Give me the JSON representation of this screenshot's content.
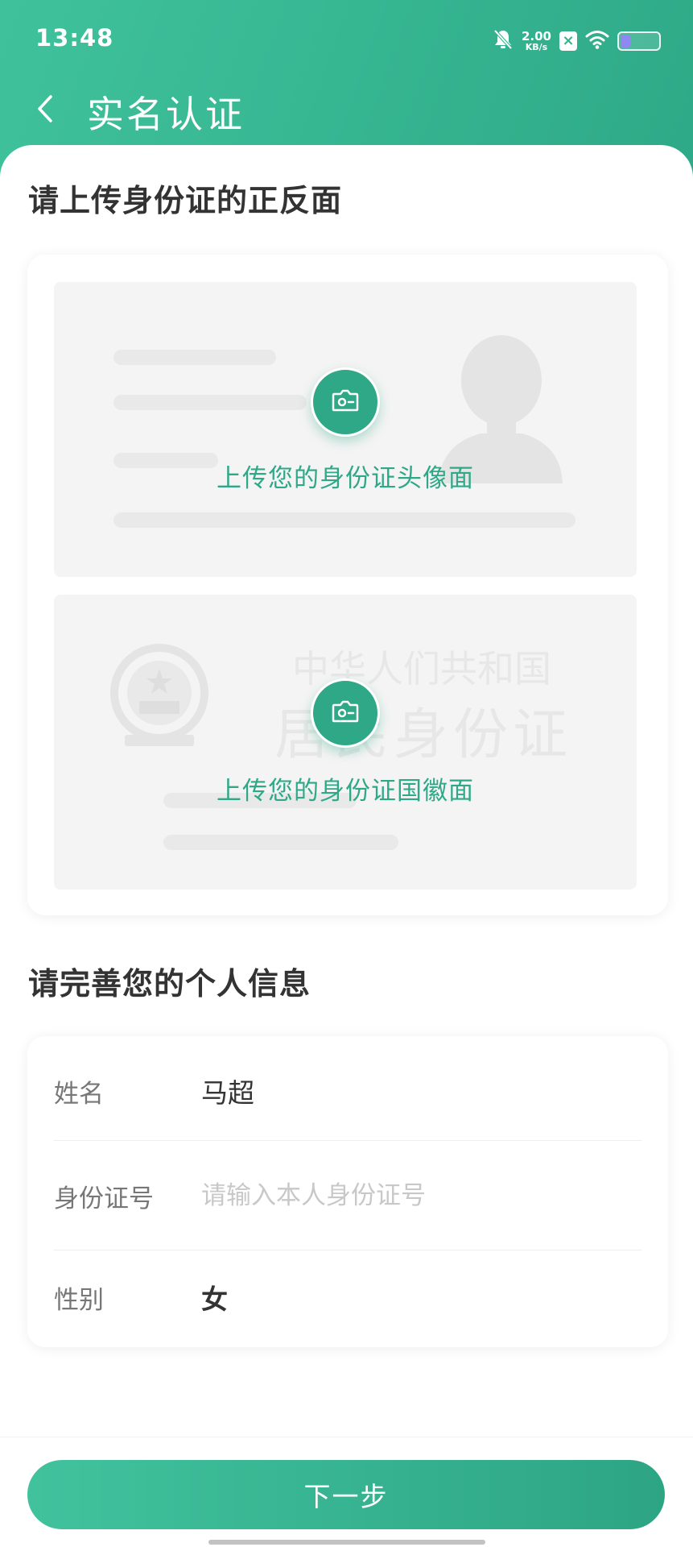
{
  "status_bar": {
    "time": "13:48",
    "net_speed_value": "2.00",
    "net_speed_unit": "KB/s",
    "icons": [
      "bell-off-icon",
      "sim-x-icon",
      "wifi-icon",
      "battery-icon"
    ],
    "battery_level": 0.2
  },
  "nav": {
    "back_icon": "chevron-left-icon",
    "title": "实名认证"
  },
  "upload_section": {
    "title": "请上传身份证的正反面",
    "front": {
      "label": "上传您的身份证头像面",
      "icon": "camera-icon"
    },
    "back": {
      "label": "上传您的身份证国徽面",
      "icon": "camera-icon",
      "watermark_line1": "中华人们共和国",
      "watermark_line2": "居民身份证"
    }
  },
  "info_section": {
    "title": "请完善您的个人信息",
    "fields": [
      {
        "label": "姓名",
        "value": "马超"
      },
      {
        "label": "身份证号",
        "value": "",
        "placeholder": "请输入本人身份证号"
      },
      {
        "label": "性别",
        "value": "女"
      }
    ]
  },
  "footer": {
    "next_label": "下一步"
  },
  "colors": {
    "primary": "#2fa887",
    "header_gradient_start": "#3fc29c",
    "header_gradient_end": "#2ea987"
  }
}
